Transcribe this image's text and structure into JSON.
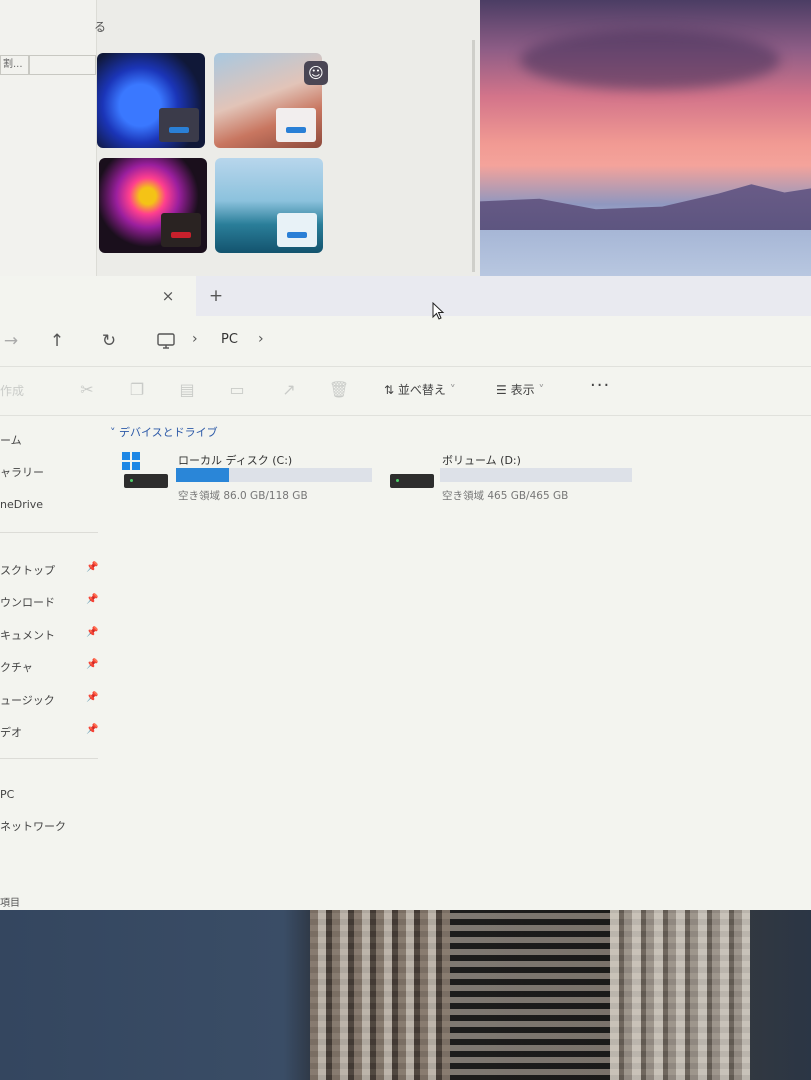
{
  "settings_window": {
    "corner_text": "る",
    "field_text": "割..."
  },
  "explorer": {
    "tab": {
      "close_icon": "×",
      "add_icon": "+"
    },
    "nav": {
      "forward_icon": "→",
      "up_icon": "↑",
      "refresh_icon": "↻",
      "breadcrumb": [
        "PC"
      ]
    },
    "toolbar": {
      "new_label": "作成",
      "sort_label": "並べ替え",
      "view_label": "表示",
      "more_label": "···"
    },
    "sidebar": {
      "items": [
        {
          "label": "ーム"
        },
        {
          "label": "ャラリー"
        },
        {
          "label": "neDrive"
        },
        {
          "label": "スクトップ",
          "pinned": true
        },
        {
          "label": "ウンロード",
          "pinned": true
        },
        {
          "label": "キュメント",
          "pinned": true
        },
        {
          "label": "クチャ",
          "pinned": true
        },
        {
          "label": "ュージック",
          "pinned": true
        },
        {
          "label": "デオ",
          "pinned": true
        },
        {
          "label": "PC"
        },
        {
          "label": "ネットワーク"
        }
      ]
    },
    "content": {
      "group_header": "デバイスとドライブ",
      "drives": [
        {
          "name": "ローカル ディスク (C:)",
          "free_text": "空き領域 86.0 GB/118 GB",
          "used_fraction": 0.27
        },
        {
          "name": "ボリューム (D:)",
          "free_text": "空き領域 465 GB/465 GB",
          "used_fraction": 0.0
        }
      ]
    },
    "status": "項目"
  },
  "colors": {
    "accent": "#2a86d8",
    "windows_logo": "#1e88e5",
    "group_header": "#2d5aa8"
  }
}
